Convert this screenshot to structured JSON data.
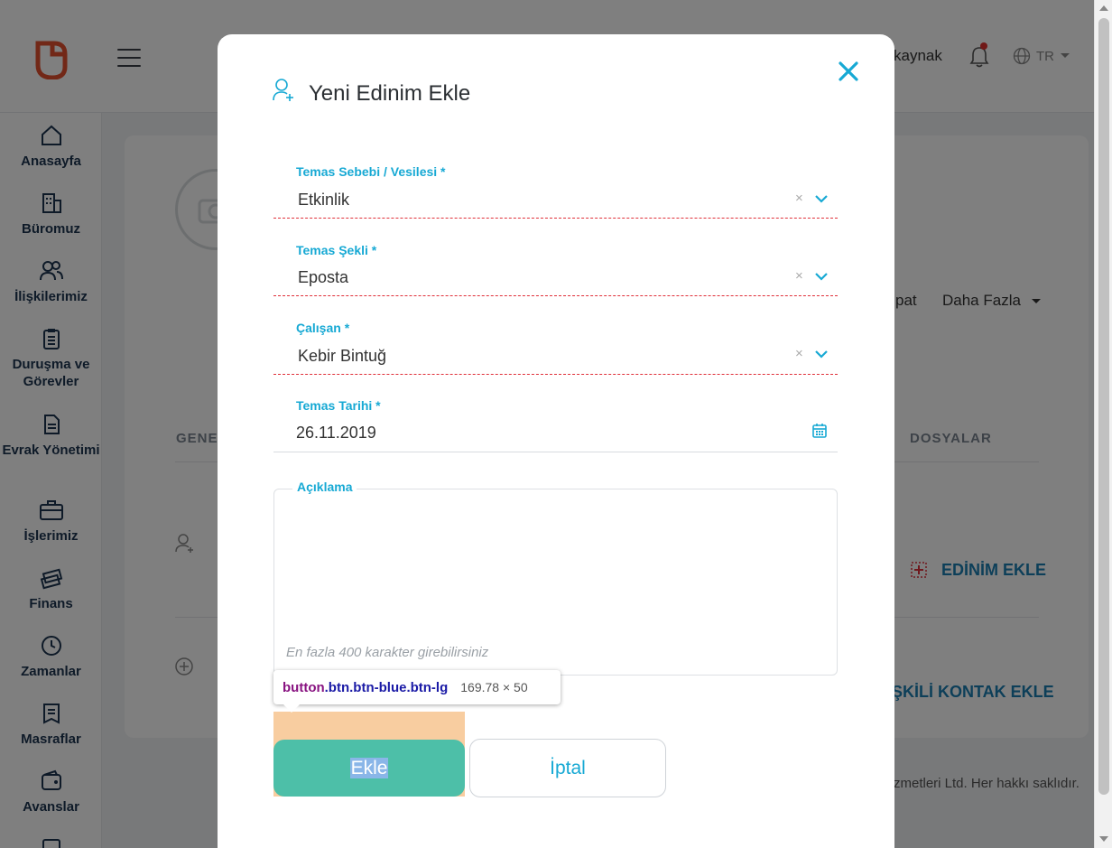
{
  "app": {
    "top_user": "kaynak",
    "lang": "TR"
  },
  "sidebar": {
    "items": [
      {
        "label": "Anasayfa"
      },
      {
        "label": "Büromuz"
      },
      {
        "label": "İlişkilerimiz"
      },
      {
        "label": "Duruşma ve Görevler"
      },
      {
        "label": "Evrak Yönetimi"
      },
      {
        "label": "İşlerimiz"
      },
      {
        "label": "Finans"
      },
      {
        "label": "Zamanlar"
      },
      {
        "label": "Masraflar"
      },
      {
        "label": "Avanslar"
      }
    ]
  },
  "background": {
    "kapat_partial": "pat",
    "more_label": "Daha Fazla",
    "tab_general_partial": "GENE",
    "tab_files": "DOSYALAR",
    "add_acquisition": "EDİNİM EKLE",
    "add_contact_partial": "ŞKİLİ KONTAK EKLE",
    "footer_partial": "zmetleri Ltd. Her hakkı saklıdır."
  },
  "modal": {
    "title": "Yeni Edinim Ekle",
    "fields": {
      "reason": {
        "label": "Temas Sebebi / Vesilesi *",
        "value": "Etkinlik"
      },
      "type": {
        "label": "Temas Şekli *",
        "value": "Eposta"
      },
      "employee": {
        "label": "Çalışan *",
        "value": "Kebir Bintuğ"
      },
      "date": {
        "label": "Temas Tarihi *",
        "value": "26.11.2019"
      },
      "description": {
        "label": "Açıklama",
        "hint": "En fazla 400 karakter girebilirsiniz"
      }
    },
    "buttons": {
      "add": "Ekle",
      "cancel": "İptal"
    }
  },
  "devtools_tooltip": {
    "tag": "button",
    "classes": ".btn.btn-blue.btn-lg",
    "dims": "169.78 × 50"
  },
  "colors": {
    "accent": "#17a9d4",
    "add_button": "#4dbfa8",
    "error_underline": "#e0303a",
    "nav_text": "#1d3550"
  }
}
